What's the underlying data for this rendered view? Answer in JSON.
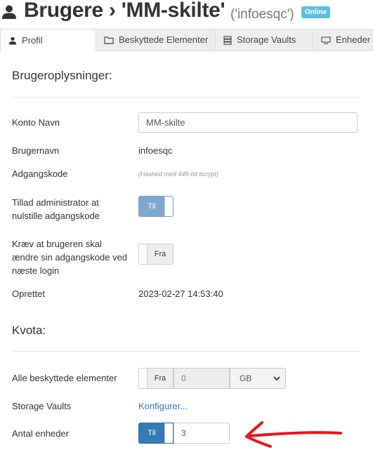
{
  "header": {
    "title": "Brugere › 'MM-skilte'",
    "subtitle": "('infoesqc')",
    "badge": "Online",
    "icon": "user-icon"
  },
  "tabs": [
    {
      "label": "Profil",
      "icon": "user-icon",
      "active": true
    },
    {
      "label": "Beskyttede Elementer",
      "icon": "folder-icon",
      "active": false
    },
    {
      "label": "Storage Vaults",
      "icon": "server-icon",
      "active": false
    },
    {
      "label": "Enheder",
      "icon": "monitor-icon",
      "active": false
    }
  ],
  "user_info": {
    "heading": "Brugeroplysninger:",
    "account_name_label": "Konto Navn",
    "account_name_value": "MM-skilte",
    "username_label": "Brugernavn",
    "username_value": "infoesqc",
    "password_label": "Adgangskode",
    "password_hint": "(Hashed med 448-bit bcrypt)",
    "admin_reset_label": "Tillad administrator at nulstille adgangskode",
    "admin_reset_toggle": "Til",
    "require_change_label": "Kræv at brugeren skal ændre sin adgangskode ved næste login",
    "require_change_toggle": "Fra",
    "created_label": "Oprettet",
    "created_value": "2023-02-27 14:53:40"
  },
  "quota": {
    "heading": "Kvota:",
    "all_protected_label": "Alle beskyttede elementer",
    "all_protected_toggle": "Fra",
    "all_protected_value": "0",
    "all_protected_unit": "GB",
    "storage_vaults_label": "Storage Vaults",
    "storage_vaults_link": "Konfigurer...",
    "device_count_label": "Antal enheder",
    "device_count_toggle": "Til",
    "device_count_value": "3"
  },
  "colors": {
    "badge": "#5bc0de",
    "toggle_on": "#337ab7",
    "link": "#337ab7",
    "annotation_arrow": "#e8151b"
  }
}
